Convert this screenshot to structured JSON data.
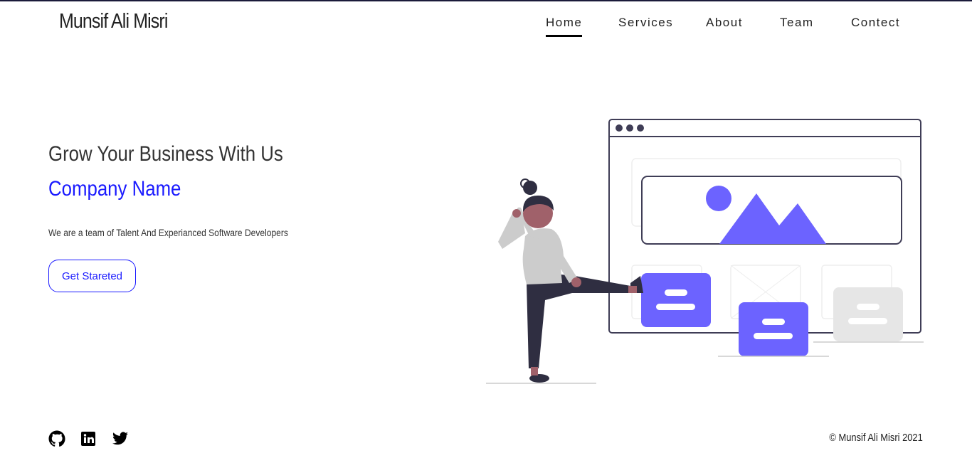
{
  "header": {
    "brand": "Munsif Ali Misri",
    "nav": [
      {
        "label": "Home",
        "active": true
      },
      {
        "label": "Services",
        "active": false
      },
      {
        "label": "About",
        "active": false
      },
      {
        "label": "Team",
        "active": false
      },
      {
        "label": "Contect",
        "active": false
      }
    ]
  },
  "hero": {
    "title": "Grow Your Business With Us",
    "company": "Company Name",
    "tagline": "We are a team of Talent And Experianced Software Developers",
    "cta_label": "Get Stareted"
  },
  "illustration": {
    "icon": "person-kicking-website-illustration",
    "accent_color": "#6c63ff"
  },
  "footer": {
    "socials": [
      "github-icon",
      "linkedin-icon",
      "twitter-icon"
    ],
    "copyright": "© Munsif Ali Misri 2021"
  },
  "colors": {
    "accent": "#1a1aff",
    "illustration_primary": "#6c63ff",
    "text": "#222222"
  }
}
